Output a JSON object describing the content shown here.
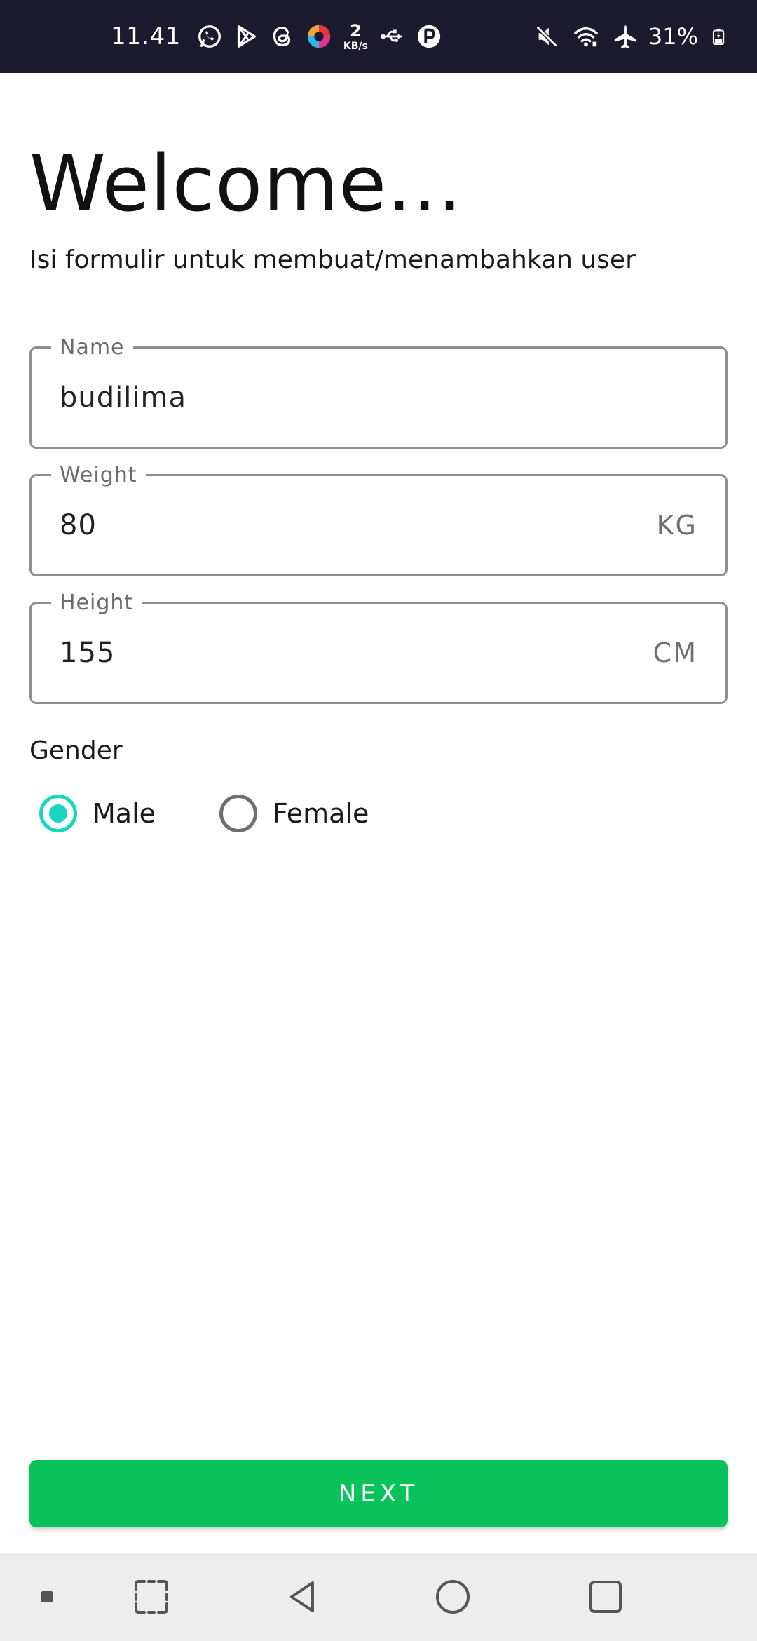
{
  "status_bar": {
    "time": "11.41",
    "net_speed_value": "2",
    "net_speed_unit": "KB/s",
    "battery": "31%",
    "left_icons": [
      "whatsapp-icon",
      "play-store-icon",
      "threads-icon",
      "colorful-app-icon",
      "usb-icon",
      "app-p-icon"
    ],
    "right_icons": [
      "mute-icon",
      "wifi-icon",
      "airplane-icon",
      "battery-icon"
    ]
  },
  "header": {
    "title": "Welcome...",
    "subtitle": "Isi formulir untuk membuat/menambahkan user"
  },
  "form": {
    "name": {
      "label": "Name",
      "value": "budilima"
    },
    "weight": {
      "label": "Weight",
      "value": "80",
      "unit": "KG"
    },
    "height": {
      "label": "Height",
      "value": "155",
      "unit": "CM"
    },
    "gender": {
      "label": "Gender",
      "options": [
        {
          "label": "Male",
          "selected": true
        },
        {
          "label": "Female",
          "selected": false
        }
      ]
    }
  },
  "actions": {
    "next_label": "NEXT"
  },
  "colors": {
    "accent_radio": "#19d6c0",
    "button_green": "#0ac25a",
    "status_bar_bg": "#1b1a2e",
    "nav_bar_bg": "#ededed"
  },
  "nav_bar": {
    "icons": [
      "small-square-icon",
      "screenshot-icon",
      "back-icon",
      "home-icon",
      "recents-icon"
    ]
  }
}
